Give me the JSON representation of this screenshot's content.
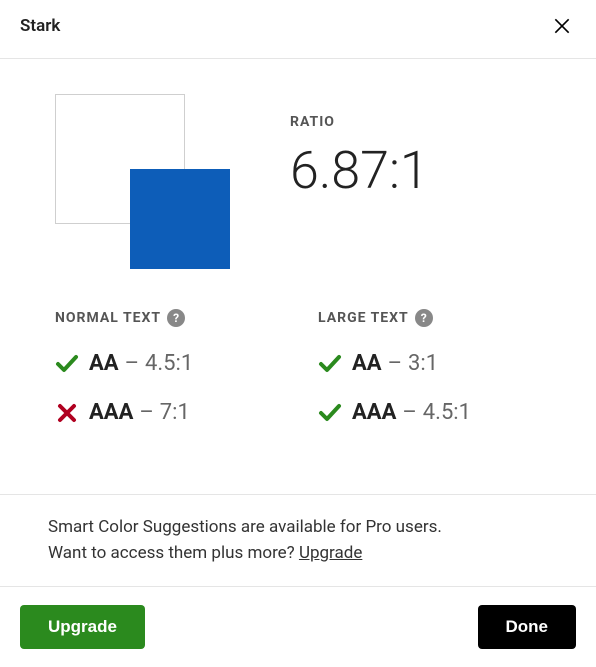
{
  "header": {
    "title": "Stark"
  },
  "swatches": {
    "bg_color": "#ffffff",
    "fg_color": "#0d5db8"
  },
  "ratio": {
    "label": "RATIO",
    "value": "6.87:1"
  },
  "normal_text": {
    "title": "NORMAL TEXT",
    "aa": {
      "pass": true,
      "name": "AA",
      "threshold": "4.5:1"
    },
    "aaa": {
      "pass": false,
      "name": "AAA",
      "threshold": "7:1"
    }
  },
  "large_text": {
    "title": "LARGE TEXT",
    "aa": {
      "pass": true,
      "name": "AA",
      "threshold": "3:1"
    },
    "aaa": {
      "pass": true,
      "name": "AAA",
      "threshold": "4.5:1"
    }
  },
  "upsell": {
    "line1": "Smart Color Suggestions are available for Pro users.",
    "line2_prefix": "Want to access them plus more? ",
    "link_label": "Upgrade"
  },
  "footer": {
    "upgrade_label": "Upgrade",
    "done_label": "Done"
  },
  "dash": "–"
}
